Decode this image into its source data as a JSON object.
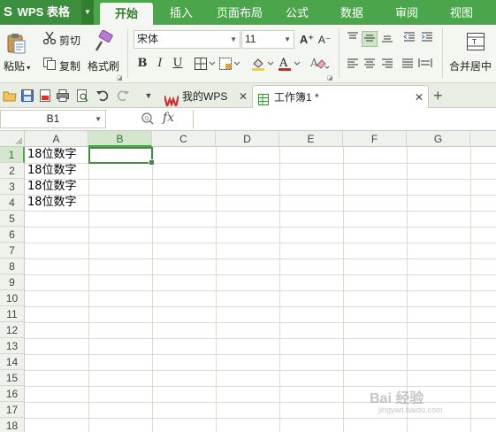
{
  "app": {
    "name": "WPS 表格",
    "logo": "S"
  },
  "menu": {
    "tabs": [
      "开始",
      "插入",
      "页面布局",
      "公式",
      "数据",
      "审阅",
      "视图"
    ],
    "active": "开始"
  },
  "ribbon": {
    "paste": "粘贴",
    "cut": "剪切",
    "copy": "复制",
    "format_painter": "格式刷",
    "font_name": "宋体",
    "font_size": "11",
    "grow_font": "A⁺",
    "shrink_font": "A⁻",
    "bold": "B",
    "italic": "I",
    "underline": "U",
    "merge_center": "合并居中"
  },
  "doc_tabs": [
    {
      "label": "我的WPS",
      "active": false
    },
    {
      "label": "工作簿1 *",
      "active": true
    }
  ],
  "add_tab": "+",
  "formula_bar": {
    "cell_ref": "B1",
    "fx": "fx",
    "content": ""
  },
  "grid": {
    "columns": [
      "A",
      "B",
      "C",
      "D",
      "E",
      "F",
      "G"
    ],
    "rows": [
      "1",
      "2",
      "3",
      "4",
      "5",
      "6",
      "7",
      "8",
      "9",
      "10",
      "11",
      "12",
      "13",
      "14",
      "15",
      "16",
      "17",
      "18"
    ],
    "selected_cell": "B1",
    "cells": [
      {
        "ref": "A1",
        "value": "18位数字"
      },
      {
        "ref": "A2",
        "value": "18位数字"
      },
      {
        "ref": "A3",
        "value": "18位数字"
      },
      {
        "ref": "A4",
        "value": "18位数字"
      }
    ]
  },
  "watermark": {
    "text": "Bai 经验",
    "sub": "jingyan.baidu.com"
  },
  "colors": {
    "brand": "#4ba54b",
    "brand_dark": "#3c8f3c",
    "selection": "#3e8e3e"
  }
}
